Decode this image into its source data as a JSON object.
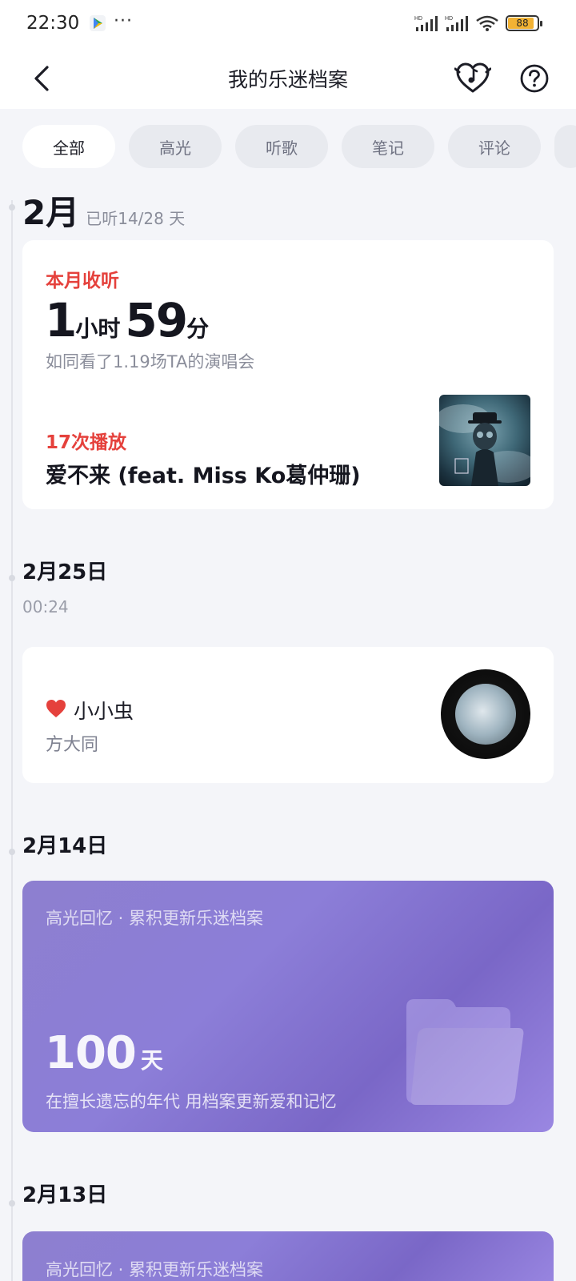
{
  "status_bar": {
    "time": "22:30",
    "more": "···",
    "battery": "88"
  },
  "header": {
    "title": "我的乐迷档案"
  },
  "tabs": [
    {
      "label": "全部",
      "active": true
    },
    {
      "label": "高光",
      "active": false
    },
    {
      "label": "听歌",
      "active": false
    },
    {
      "label": "笔记",
      "active": false
    },
    {
      "label": "评论",
      "active": false
    }
  ],
  "month": {
    "title": "2月",
    "listened": "已听14/28 天",
    "total_label": "本月收听",
    "hours": "1",
    "hours_unit": "小时",
    "minutes": "59",
    "minutes_unit": "分",
    "compare": "如同看了1.19场TA的演唱会",
    "play_count": "17次播放",
    "top_song": "爱不来 (feat. Miss Ko葛仲珊)"
  },
  "day1": {
    "date": "2月25日",
    "time": "00:24",
    "song": "小小虫",
    "artist": "方大同"
  },
  "day2": {
    "date": "2月14日",
    "subtitle": "高光回忆 · 累积更新乐迷档案",
    "days": "100",
    "days_unit": "天",
    "desc": "在擅长遗忘的年代 用档案更新爱和记忆"
  },
  "day3": {
    "date": "2月13日",
    "subtitle": "高光回忆 · 累积更新乐迷档案"
  },
  "colors": {
    "accent_red": "#e5413c",
    "highlight_purple": "#8c7ed8",
    "background": "#f4f5f9"
  }
}
